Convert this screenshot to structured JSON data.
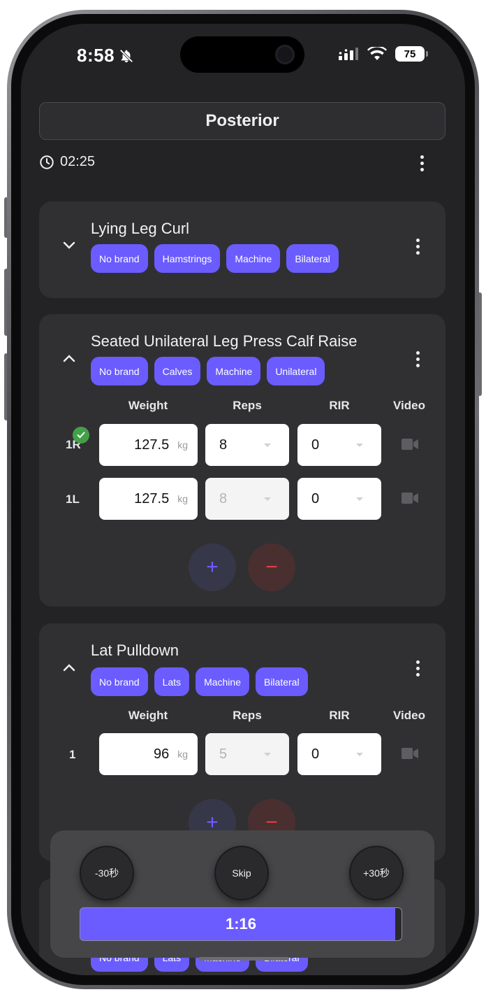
{
  "status_bar": {
    "time": "8:58",
    "battery": "75"
  },
  "workout": {
    "title": "Posterior",
    "elapsed": "02:25"
  },
  "exercises": [
    {
      "name": "Lying Leg Curl",
      "tags": [
        "No brand",
        "Hamstrings",
        "Machine",
        "Bilateral"
      ]
    },
    {
      "name": "Seated Unilateral Leg Press Calf Raise",
      "tags": [
        "No brand",
        "Calves",
        "Machine",
        "Unilateral"
      ],
      "columns": {
        "weight": "Weight",
        "reps": "Reps",
        "rir": "RIR",
        "video": "Video"
      },
      "sets": [
        {
          "label": "1R",
          "weight": "127.5",
          "unit": "kg",
          "reps": "8",
          "rir": "0",
          "completed": true
        },
        {
          "label": "1L",
          "weight": "127.5",
          "unit": "kg",
          "reps": "8",
          "rir": "0",
          "completed": false
        }
      ],
      "add_symbol": "+",
      "remove_symbol": "−"
    },
    {
      "name": "Lat Pulldown",
      "tags": [
        "No brand",
        "Lats",
        "Machine",
        "Bilateral"
      ],
      "columns": {
        "weight": "Weight",
        "reps": "Reps",
        "rir": "RIR",
        "video": "Video"
      },
      "sets": [
        {
          "label": "1",
          "weight": "96",
          "unit": "kg",
          "reps": "5",
          "rir": "0",
          "completed": false
        }
      ],
      "add_symbol": "+",
      "remove_symbol": "−"
    },
    {
      "name": "",
      "tags": [
        "No brand",
        "Lats",
        "Machine",
        "Bilateral"
      ]
    }
  ],
  "rest_timer": {
    "minus_label": "-30秒",
    "skip_label": "Skip",
    "plus_label": "+30秒",
    "remaining": "1:16",
    "progress": 0.98
  },
  "colors": {
    "accent": "#6a5cff",
    "remove": "#e0403a",
    "check": "#43a047"
  },
  "icons": [
    "bell-slash-icon",
    "signal-icon",
    "wifi-icon",
    "battery-icon",
    "clock-icon",
    "more-vert-icon",
    "chevron-down-icon",
    "chevron-up-icon",
    "check-icon",
    "video-camera-icon",
    "plus-icon",
    "minus-icon"
  ]
}
